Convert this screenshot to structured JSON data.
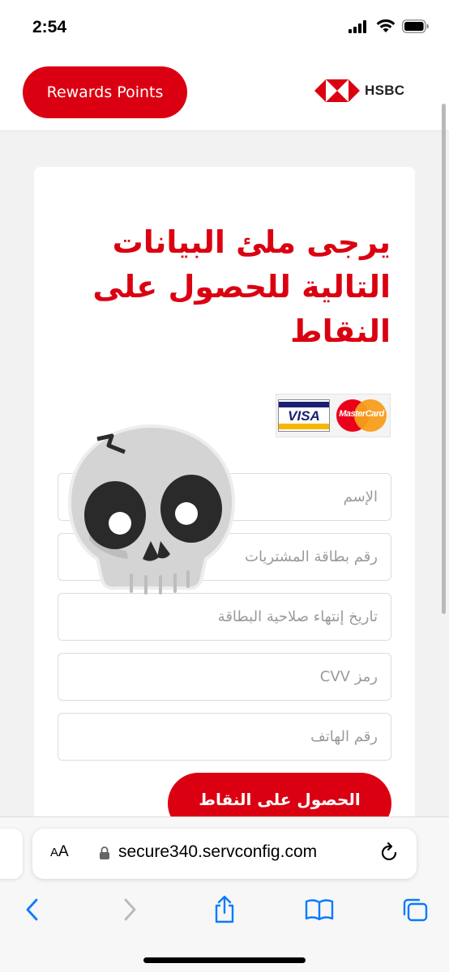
{
  "status_bar": {
    "time": "2:54"
  },
  "header": {
    "rewards_button_label": "Rewards Points",
    "brand_name": "HSBC",
    "brand_color": "#db0011"
  },
  "form": {
    "title": "يرجى ملئ البيانات التالية للحصول على النقاط",
    "accepted_cards": [
      "VISA",
      "MasterCard"
    ],
    "fields": {
      "name_placeholder": "الإسم",
      "card_number_placeholder": "رقم بطاقة المشتريات",
      "expiry_placeholder": "تاريخ إنتهاء صلاحية البطاقة",
      "cvv_placeholder": "رمز CVV",
      "phone_placeholder": "رقم الهاتف"
    },
    "submit_label": "الحصول على النقاط"
  },
  "browser": {
    "aa_label_large": "A",
    "aa_label_small": "A",
    "url": "secure340.servconfig.com",
    "toolbar_icons": [
      "back-icon",
      "forward-icon",
      "share-icon",
      "bookmarks-icon",
      "tabs-icon"
    ]
  }
}
